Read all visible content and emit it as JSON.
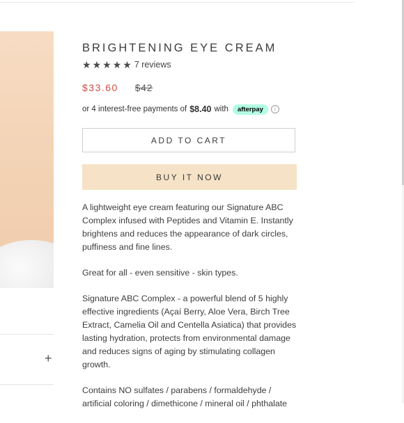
{
  "product": {
    "title": "BRIGHTENING EYE CREAM",
    "rating": {
      "stars": 5,
      "reviews_label": "7 reviews"
    },
    "price": {
      "sale": "$33.60",
      "compare_at": "$42"
    },
    "installments": {
      "prefix": "or 4 interest-free payments of",
      "amount": "$8.40",
      "suffix": "with",
      "provider": "afterpay"
    },
    "buttons": {
      "add_to_cart": "ADD TO CART",
      "buy_now": "BUY IT NOW"
    },
    "description": [
      "A lightweight eye cream featuring our Signature ABC Complex infused with Peptides and Vitamin E. Instantly brightens and reduces the appearance of dark circles, puffiness and fine lines.",
      "Great for all - even sensitive - skin types.",
      "Signature ABC Complex - a powerful blend of 5 highly effective ingredients (Açaí Berry, Aloe Vera, Birch Tree Extract, Camelia Oil and Centella Asiatica) that provides lasting hydration, protects from environmental damage and reduces signs of aging by stimulating collagen growth.",
      "Contains NO sulfates / parabens / formaldehyde / artificial coloring / dimethicone / mineral oil / phthalate"
    ]
  },
  "accordion": {
    "toggle_symbol": "+"
  },
  "colors": {
    "sale_price": "#d24b43",
    "buy_now_bg": "#f6e2c6",
    "afterpay_badge": "#b2fce4"
  },
  "icons": {
    "star": "star-icon",
    "info": "info-icon",
    "plus": "plus-icon"
  }
}
